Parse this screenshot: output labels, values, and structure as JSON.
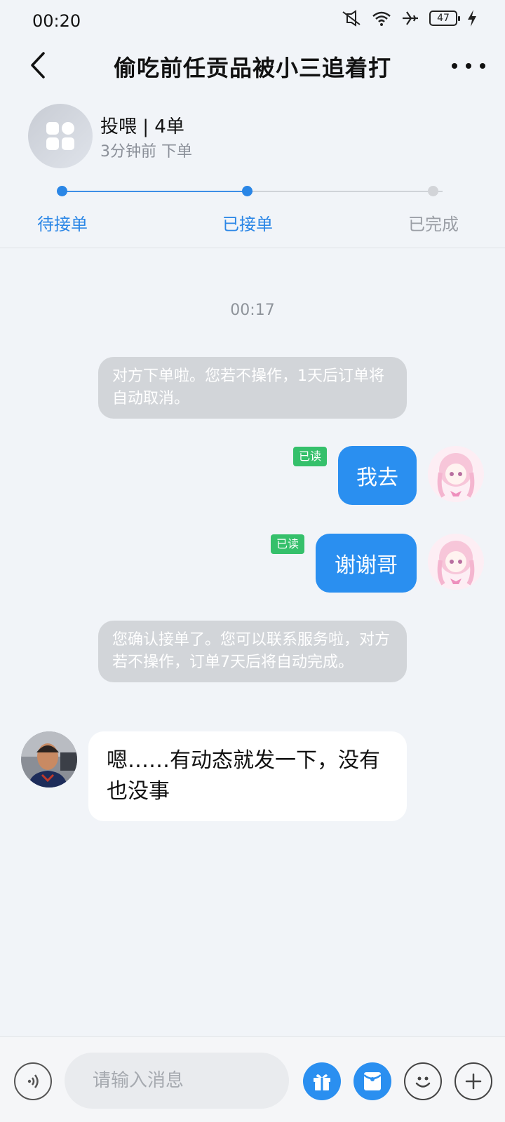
{
  "status": {
    "time": "00:20",
    "battery": "47"
  },
  "header": {
    "title": "偷吃前任贡品被小三追着打"
  },
  "service": {
    "name": "投喂 | 4单",
    "time": "3分钟前 下单",
    "progress": 0.5,
    "steps": [
      {
        "label": "待接单",
        "state": "done"
      },
      {
        "label": "已接单",
        "state": "current"
      },
      {
        "label": "已完成",
        "state": "pending"
      }
    ]
  },
  "chat": {
    "time": "00:17",
    "system_1": "对方下单啦。您若不操作，1天后订单将自动取消。",
    "out_1": {
      "text": "我去",
      "read": "已读"
    },
    "out_2": {
      "text": "谢谢哥",
      "read": "已读"
    },
    "system_2": "您确认接单了。您可以联系服务啦，对方若不操作，订单7天后将自动完成。",
    "in_1": "嗯……有动态就发一下，没有也没事"
  },
  "input": {
    "placeholder": "请输入消息"
  },
  "colors": {
    "accent": "#2a8ff0",
    "read_badge": "#35c06b",
    "system_bubble": "#d2d5d9"
  },
  "icons": [
    "back-arrow-icon",
    "more-icon",
    "voice-icon",
    "gift-icon",
    "red-packet-icon",
    "emoji-icon",
    "plus-icon"
  ]
}
